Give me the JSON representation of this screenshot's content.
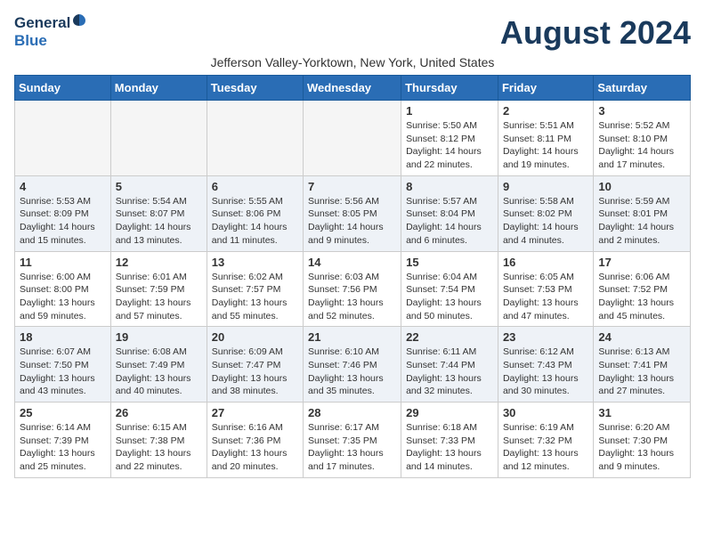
{
  "header": {
    "logo_general": "General",
    "logo_blue": "Blue",
    "month_title": "August 2024",
    "subtitle": "Jefferson Valley-Yorktown, New York, United States"
  },
  "weekdays": [
    "Sunday",
    "Monday",
    "Tuesday",
    "Wednesday",
    "Thursday",
    "Friday",
    "Saturday"
  ],
  "weeks": [
    [
      {
        "day": "",
        "info": ""
      },
      {
        "day": "",
        "info": ""
      },
      {
        "day": "",
        "info": ""
      },
      {
        "day": "",
        "info": ""
      },
      {
        "day": "1",
        "info": "Sunrise: 5:50 AM\nSunset: 8:12 PM\nDaylight: 14 hours\nand 22 minutes."
      },
      {
        "day": "2",
        "info": "Sunrise: 5:51 AM\nSunset: 8:11 PM\nDaylight: 14 hours\nand 19 minutes."
      },
      {
        "day": "3",
        "info": "Sunrise: 5:52 AM\nSunset: 8:10 PM\nDaylight: 14 hours\nand 17 minutes."
      }
    ],
    [
      {
        "day": "4",
        "info": "Sunrise: 5:53 AM\nSunset: 8:09 PM\nDaylight: 14 hours\nand 15 minutes."
      },
      {
        "day": "5",
        "info": "Sunrise: 5:54 AM\nSunset: 8:07 PM\nDaylight: 14 hours\nand 13 minutes."
      },
      {
        "day": "6",
        "info": "Sunrise: 5:55 AM\nSunset: 8:06 PM\nDaylight: 14 hours\nand 11 minutes."
      },
      {
        "day": "7",
        "info": "Sunrise: 5:56 AM\nSunset: 8:05 PM\nDaylight: 14 hours\nand 9 minutes."
      },
      {
        "day": "8",
        "info": "Sunrise: 5:57 AM\nSunset: 8:04 PM\nDaylight: 14 hours\nand 6 minutes."
      },
      {
        "day": "9",
        "info": "Sunrise: 5:58 AM\nSunset: 8:02 PM\nDaylight: 14 hours\nand 4 minutes."
      },
      {
        "day": "10",
        "info": "Sunrise: 5:59 AM\nSunset: 8:01 PM\nDaylight: 14 hours\nand 2 minutes."
      }
    ],
    [
      {
        "day": "11",
        "info": "Sunrise: 6:00 AM\nSunset: 8:00 PM\nDaylight: 13 hours\nand 59 minutes."
      },
      {
        "day": "12",
        "info": "Sunrise: 6:01 AM\nSunset: 7:59 PM\nDaylight: 13 hours\nand 57 minutes."
      },
      {
        "day": "13",
        "info": "Sunrise: 6:02 AM\nSunset: 7:57 PM\nDaylight: 13 hours\nand 55 minutes."
      },
      {
        "day": "14",
        "info": "Sunrise: 6:03 AM\nSunset: 7:56 PM\nDaylight: 13 hours\nand 52 minutes."
      },
      {
        "day": "15",
        "info": "Sunrise: 6:04 AM\nSunset: 7:54 PM\nDaylight: 13 hours\nand 50 minutes."
      },
      {
        "day": "16",
        "info": "Sunrise: 6:05 AM\nSunset: 7:53 PM\nDaylight: 13 hours\nand 47 minutes."
      },
      {
        "day": "17",
        "info": "Sunrise: 6:06 AM\nSunset: 7:52 PM\nDaylight: 13 hours\nand 45 minutes."
      }
    ],
    [
      {
        "day": "18",
        "info": "Sunrise: 6:07 AM\nSunset: 7:50 PM\nDaylight: 13 hours\nand 43 minutes."
      },
      {
        "day": "19",
        "info": "Sunrise: 6:08 AM\nSunset: 7:49 PM\nDaylight: 13 hours\nand 40 minutes."
      },
      {
        "day": "20",
        "info": "Sunrise: 6:09 AM\nSunset: 7:47 PM\nDaylight: 13 hours\nand 38 minutes."
      },
      {
        "day": "21",
        "info": "Sunrise: 6:10 AM\nSunset: 7:46 PM\nDaylight: 13 hours\nand 35 minutes."
      },
      {
        "day": "22",
        "info": "Sunrise: 6:11 AM\nSunset: 7:44 PM\nDaylight: 13 hours\nand 32 minutes."
      },
      {
        "day": "23",
        "info": "Sunrise: 6:12 AM\nSunset: 7:43 PM\nDaylight: 13 hours\nand 30 minutes."
      },
      {
        "day": "24",
        "info": "Sunrise: 6:13 AM\nSunset: 7:41 PM\nDaylight: 13 hours\nand 27 minutes."
      }
    ],
    [
      {
        "day": "25",
        "info": "Sunrise: 6:14 AM\nSunset: 7:39 PM\nDaylight: 13 hours\nand 25 minutes."
      },
      {
        "day": "26",
        "info": "Sunrise: 6:15 AM\nSunset: 7:38 PM\nDaylight: 13 hours\nand 22 minutes."
      },
      {
        "day": "27",
        "info": "Sunrise: 6:16 AM\nSunset: 7:36 PM\nDaylight: 13 hours\nand 20 minutes."
      },
      {
        "day": "28",
        "info": "Sunrise: 6:17 AM\nSunset: 7:35 PM\nDaylight: 13 hours\nand 17 minutes."
      },
      {
        "day": "29",
        "info": "Sunrise: 6:18 AM\nSunset: 7:33 PM\nDaylight: 13 hours\nand 14 minutes."
      },
      {
        "day": "30",
        "info": "Sunrise: 6:19 AM\nSunset: 7:32 PM\nDaylight: 13 hours\nand 12 minutes."
      },
      {
        "day": "31",
        "info": "Sunrise: 6:20 AM\nSunset: 7:30 PM\nDaylight: 13 hours\nand 9 minutes."
      }
    ]
  ]
}
